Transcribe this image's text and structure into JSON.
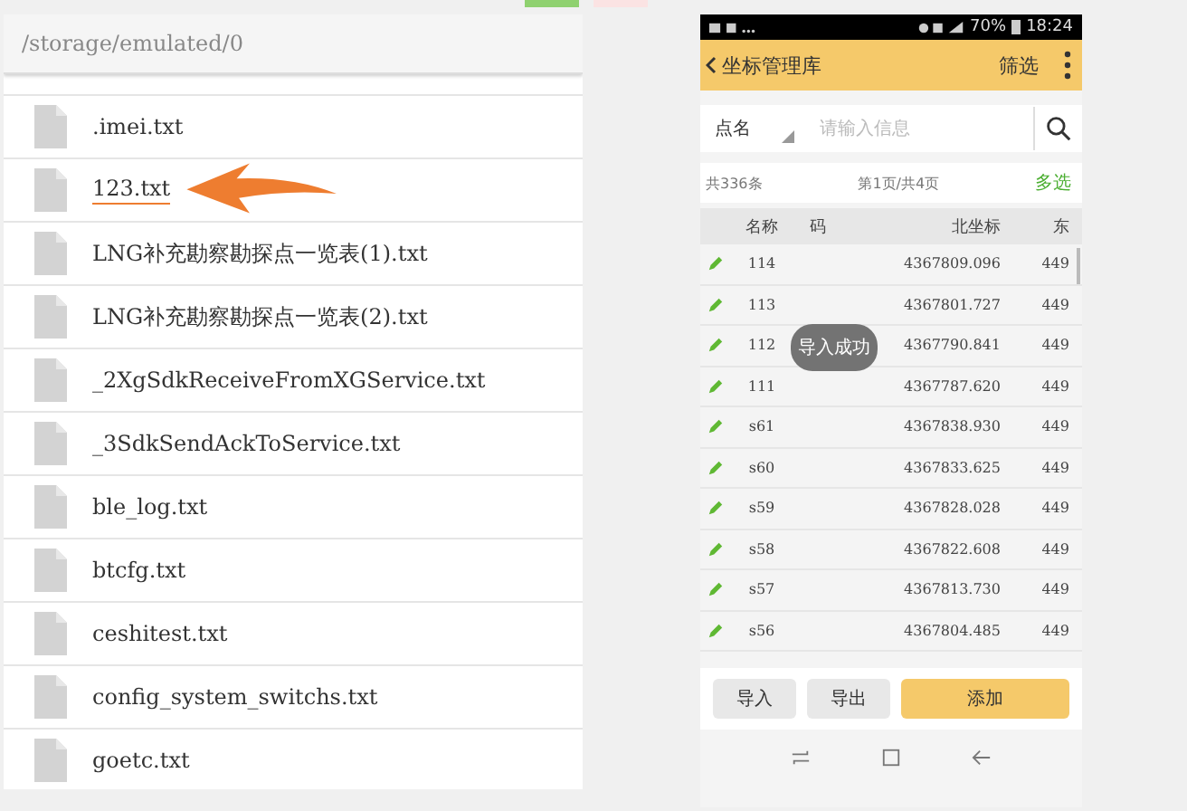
{
  "file_browser": {
    "path": "/storage/emulated/0",
    "files": [
      {
        "name": ".imei.txt",
        "highlighted": false
      },
      {
        "name": "123.txt",
        "highlighted": true
      },
      {
        "name": "LNG补充勘察勘探点一览表(1).txt",
        "highlighted": false
      },
      {
        "name": "LNG补充勘察勘探点一览表(2).txt",
        "highlighted": false
      },
      {
        "name": "_2XgSdkReceiveFromXGService.txt",
        "highlighted": false
      },
      {
        "name": "_3SdkSendAckToService.txt",
        "highlighted": false
      },
      {
        "name": "ble_log.txt",
        "highlighted": false
      },
      {
        "name": "btcfg.txt",
        "highlighted": false
      },
      {
        "name": "ceshitest.txt",
        "highlighted": false
      },
      {
        "name": "config_system_switchs.txt",
        "highlighted": false
      },
      {
        "name": "goetc.txt",
        "highlighted": false
      }
    ]
  },
  "phone": {
    "status_bar": {
      "battery": "70%",
      "time": "18:24"
    },
    "header": {
      "back": "坐标管理库",
      "action": "筛选"
    },
    "search": {
      "field": "点名",
      "placeholder": "请输入信息"
    },
    "summary": {
      "total": "共336条",
      "page": "第1页/共4页",
      "multi": "多选"
    },
    "table": {
      "columns": [
        "名称",
        "码",
        "北坐标",
        "东"
      ],
      "rows": [
        [
          "114",
          "",
          "4367809.096",
          "449"
        ],
        [
          "113",
          "",
          "4367801.727",
          "449"
        ],
        [
          "112",
          "",
          "4367790.841",
          "449"
        ],
        [
          "111",
          "",
          "4367787.620",
          "449"
        ],
        [
          "s61",
          "",
          "4367838.930",
          "449"
        ],
        [
          "s60",
          "",
          "4367833.625",
          "449"
        ],
        [
          "s59",
          "",
          "4367828.028",
          "449"
        ],
        [
          "s58",
          "",
          "4367822.608",
          "449"
        ],
        [
          "s57",
          "",
          "4367813.730",
          "449"
        ],
        [
          "s56",
          "",
          "4367804.485",
          "449"
        ]
      ]
    },
    "toast": "导入成功",
    "buttons": [
      {
        "label": "导入",
        "primary": false
      },
      {
        "label": "导出",
        "primary": false
      },
      {
        "label": "添加",
        "primary": true
      }
    ]
  }
}
